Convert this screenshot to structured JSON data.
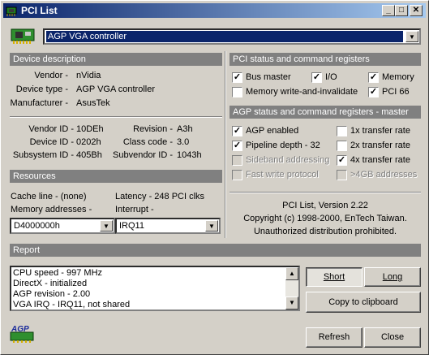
{
  "window": {
    "title": "PCI List",
    "minimize_label": "_",
    "maximize_label": "□",
    "close_label": "✕"
  },
  "device_combo": {
    "selected": "AGP VGA controller",
    "arrow": "▼"
  },
  "device_description": {
    "header": "Device description",
    "vendor_label": "Vendor -",
    "vendor_value": "nVidia",
    "type_label": "Device type -",
    "type_value": "AGP VGA controller",
    "manufacturer_label": "Manufacturer -",
    "manufacturer_value": "AsusTek",
    "vendor_id_label": "Vendor ID -",
    "vendor_id_value": "10DEh",
    "device_id_label": "Device ID -",
    "device_id_value": "0202h",
    "subsystem_id_label": "Subsystem ID -",
    "subsystem_id_value": "405Bh",
    "revision_label": "Revision -",
    "revision_value": "A3h",
    "class_code_label": "Class code -",
    "class_code_value": "3.0",
    "subvendor_id_label": "Subvendor ID -",
    "subvendor_id_value": "1043h"
  },
  "resources": {
    "header": "Resources",
    "cache_line": "Cache line - (none)",
    "latency": "Latency - 248 PCI clks",
    "memory_label": "Memory addresses -",
    "interrupt_label": "Interrupt -",
    "memory_value": "D4000000h",
    "interrupt_value": "IRQ11",
    "arrow": "▼"
  },
  "pci_status": {
    "header": "PCI status and command registers",
    "bus_master": "Bus master",
    "io": "I/O",
    "memory": "Memory",
    "mwi": "Memory write-and-invalidate",
    "pci66": "PCI 66"
  },
  "agp_status": {
    "header": "AGP status and command registers - master",
    "agp_enabled": "AGP enabled",
    "pipeline": "Pipeline depth - 32",
    "sideband": "Sideband addressing",
    "fast_write": "Fast write protocol",
    "rate1x": "1x transfer rate",
    "rate2x": "2x transfer rate",
    "rate4x": "4x transfer rate",
    "gt4gb": ">4GB addresses",
    "check": "✓"
  },
  "about": {
    "version": "PCI List, Version 2.22",
    "copyright": "Copyright (c) 1998-2000, EnTech Taiwan.",
    "notice": "Unauthorized distribution prohibited."
  },
  "report": {
    "header": "Report",
    "lines": [
      "CPU speed - 997 MHz",
      "DirectX - initialized",
      "AGP revision - 2.00",
      "VGA IRQ - IRQ11, not shared"
    ],
    "up": "▲",
    "down": "▼"
  },
  "buttons": {
    "short": "Short",
    "long": "Long",
    "copy": "Copy to clipboard",
    "refresh": "Refresh",
    "close": "Close"
  },
  "logo": {
    "text": "AGP"
  }
}
